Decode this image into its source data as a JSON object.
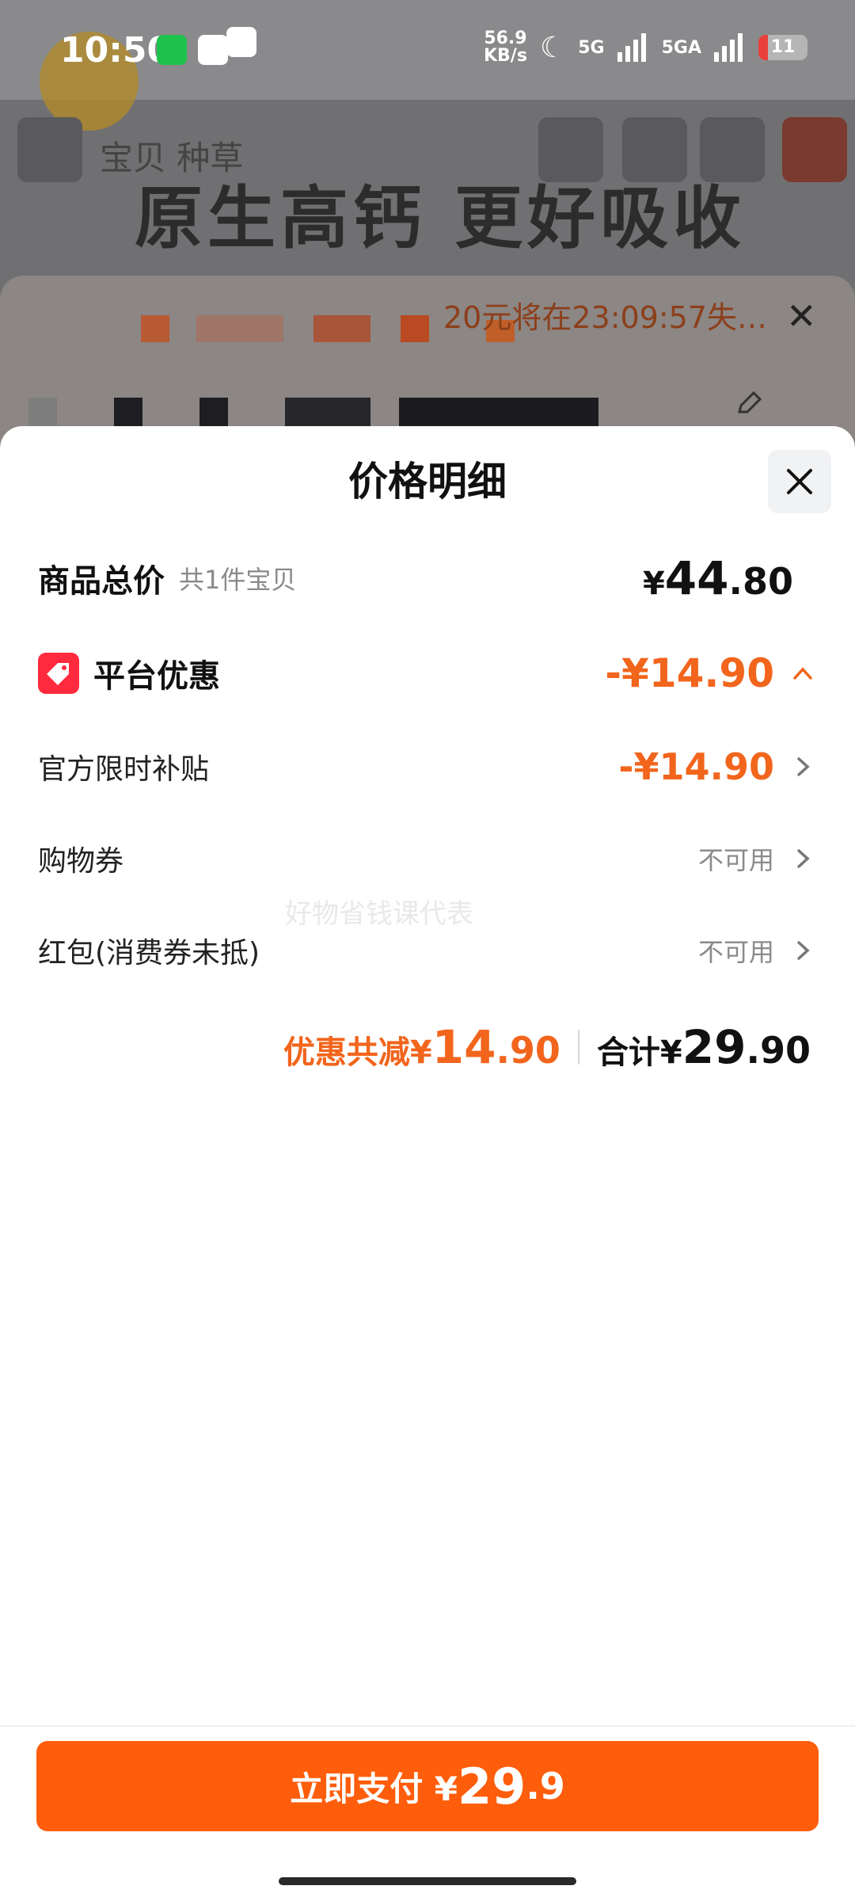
{
  "status_bar": {
    "time": "10:50",
    "net_speed_value": "56.9",
    "net_speed_unit": "KB/s",
    "signal1": "5G",
    "signal2": "5GA",
    "battery": "11"
  },
  "background": {
    "nav_text": "宝贝  种草",
    "banner_text": "原生高钙  更好吸收",
    "timer_text": "20元将在23:09:57失…"
  },
  "sheet": {
    "title": "价格明细",
    "watermark": "好物省钱课代表",
    "total": {
      "label": "商品总价",
      "sub": "共1件宝贝",
      "currency": "¥",
      "int": "44",
      "dec": ".80"
    },
    "platform": {
      "label": "平台优惠",
      "amount": "-¥14.90"
    },
    "subsidy": {
      "label": "官方限时补贴",
      "amount": "-¥14.90"
    },
    "coupon": {
      "label": "购物券",
      "status": "不可用"
    },
    "redpacket": {
      "label": "红包(消费券未抵)",
      "status": "不可用"
    },
    "summary": {
      "discount_label": "优惠共减¥",
      "discount_int": "14",
      "discount_dec": ".90",
      "total_label": "合计¥",
      "total_int": "29",
      "total_dec": ".90"
    }
  },
  "footer": {
    "pay_label": "立即支付 ¥",
    "pay_int": "29",
    "pay_dec": ".9"
  },
  "colors": {
    "accent": "#f2651c",
    "pay_button": "#fe5d0b",
    "tag_icon": "#ff2a3d"
  }
}
